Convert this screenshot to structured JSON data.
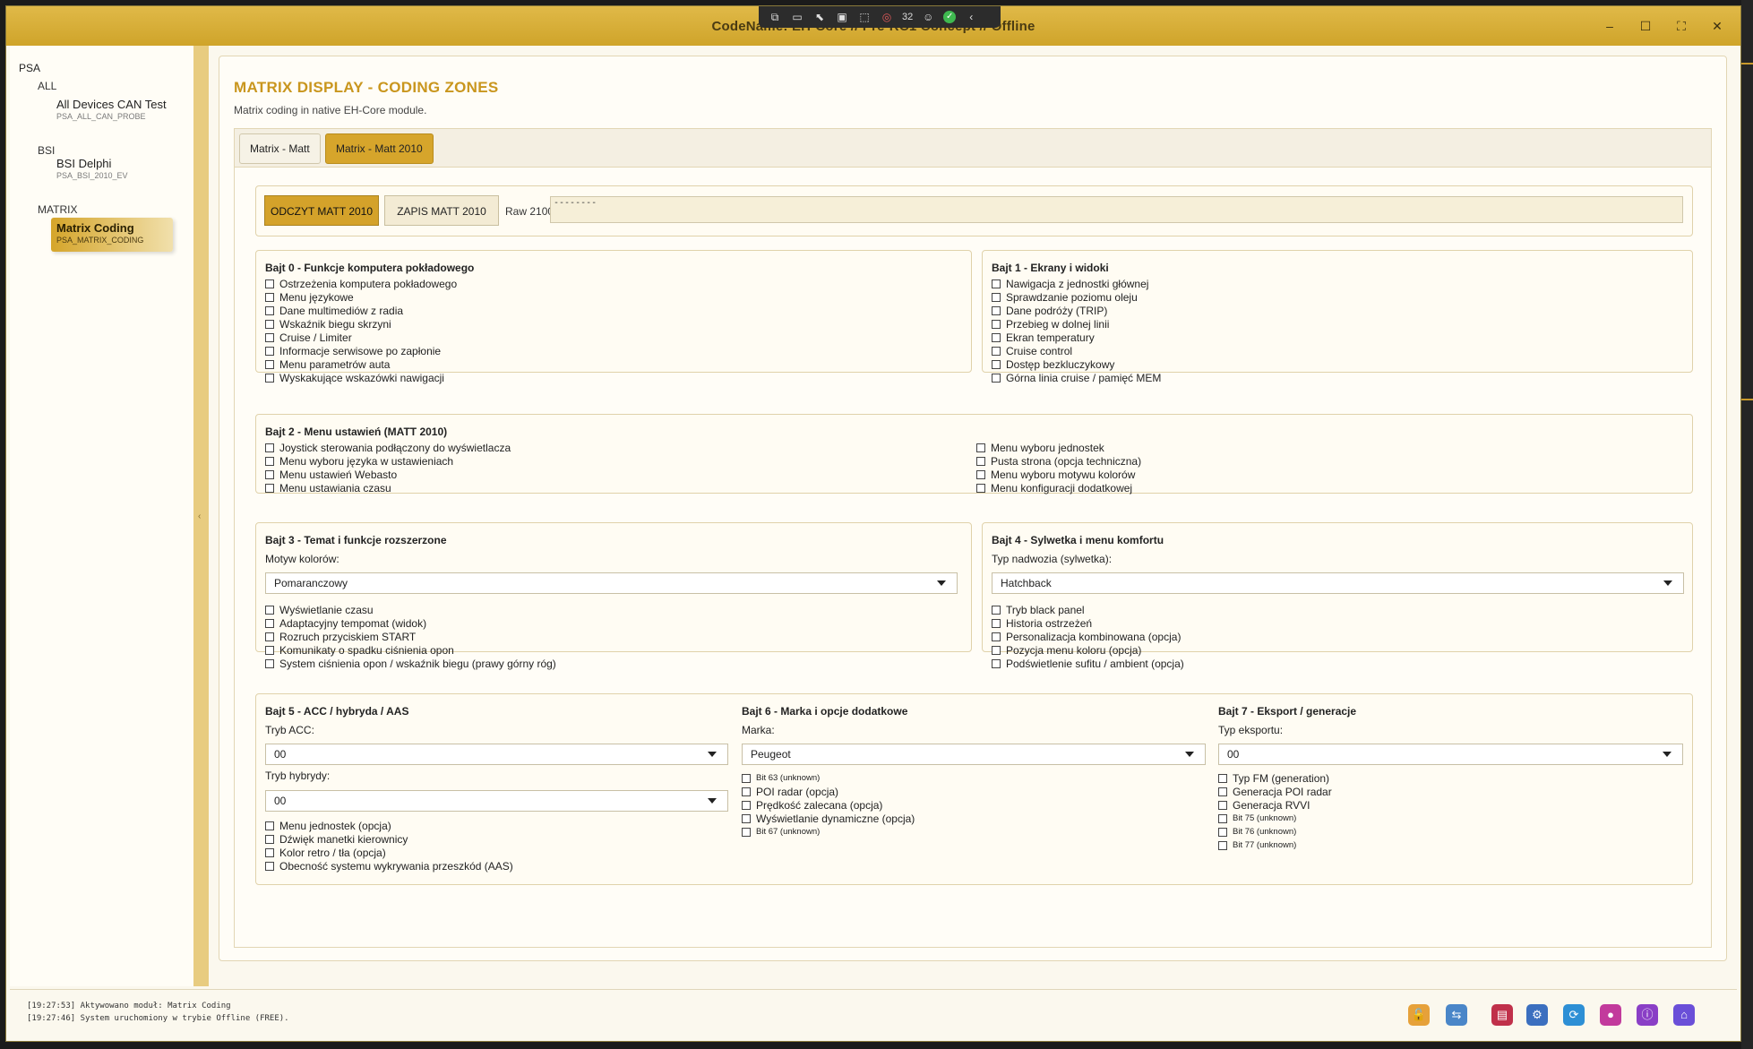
{
  "window": {
    "title": "CodeName: EH-Core // Pre-RC1 Concept // Offline",
    "overlay": {
      "counter": "32"
    },
    "controls": {
      "minimize": "–",
      "maximize": "☐",
      "fullscreen": "⛶",
      "close": "✕"
    }
  },
  "sidebar": {
    "root": "PSA",
    "groups": [
      {
        "label": "ALL",
        "items": [
          {
            "title": "All Devices CAN Test",
            "code": "PSA_ALL_CAN_PROBE"
          }
        ]
      },
      {
        "label": "BSI",
        "items": [
          {
            "title": "BSI Delphi",
            "code": "PSA_BSI_2010_EV"
          }
        ]
      },
      {
        "label": "MATRIX",
        "items": [
          {
            "title": "Matrix Coding",
            "code": "PSA_MATRIX_CODING"
          }
        ]
      }
    ]
  },
  "page": {
    "title": "MATRIX DISPLAY - CODING ZONES",
    "subtitle": "Matrix coding in native EH-Core module.",
    "tabs": [
      "Matrix - Matt",
      "Matrix - Matt 2010"
    ],
    "active_tab": "Matrix - Matt 2010"
  },
  "actions": {
    "read_label": "ODCZYT MATT 2010",
    "write_label": "ZAPIS MATT 2010",
    "raw_label": "Raw 2100:",
    "raw_value": "--------"
  },
  "byte0": {
    "title": "Bajt 0 - Funkcje komputera pokładowego",
    "items": [
      "Ostrzeżenia komputera pokładowego",
      "Menu językowe",
      "Dane multimediów z radia",
      "Wskaźnik biegu skrzyni",
      "Cruise / Limiter",
      "Informacje serwisowe po zapłonie",
      "Menu parametrów auta",
      "Wyskakujące wskazówki nawigacji"
    ]
  },
  "byte1": {
    "title": "Bajt 1 - Ekrany i widoki",
    "items": [
      "Nawigacja z jednostki głównej",
      "Sprawdzanie poziomu oleju",
      "Dane podróży (TRIP)",
      "Przebieg w dolnej linii",
      "Ekran temperatury",
      "Cruise control",
      "Dostęp bezkluczykowy",
      "Górna linia cruise / pamięć MEM"
    ]
  },
  "byte2": {
    "title": "Bajt 2 - Menu ustawień (MATT 2010)",
    "left": [
      "Joystick sterowania podłączony do wyświetlacza",
      "Menu wyboru języka w ustawieniach",
      "Menu ustawień Webasto",
      "Menu ustawiania czasu"
    ],
    "right": [
      "Menu wyboru jednostek",
      "Pusta strona (opcja techniczna)",
      "Menu wyboru motywu kolorów",
      "Menu konfiguracji dodatkowej"
    ]
  },
  "byte3": {
    "title": "Bajt 3 - Temat i funkcje rozszerzone",
    "select_label": "Motyw kolorów:",
    "select_value": "Pomaranczowy",
    "items": [
      "Wyświetlanie czasu",
      "Adaptacyjny tempomat (widok)",
      "Rozruch przyciskiem START",
      "Komunikaty o spadku ciśnienia opon",
      "System ciśnienia opon / wskaźnik biegu (prawy górny róg)"
    ]
  },
  "byte4": {
    "title": "Bajt 4 - Sylwetka i menu komfortu",
    "select_label": "Typ nadwozia (sylwetka):",
    "select_value": "Hatchback",
    "items": [
      "Tryb black panel",
      "Historia ostrzeżeń",
      "Personalizacja kombinowana (opcja)",
      "Pozycja menu koloru (opcja)",
      "Podświetlenie sufitu / ambient (opcja)"
    ]
  },
  "byte5": {
    "title": "Bajt 5 - ACC / hybryda / AAS",
    "acc_label": "Tryb ACC:",
    "acc_value": "00",
    "hybrid_label": "Tryb hybrydy:",
    "hybrid_value": "00",
    "items": [
      "Menu jednostek (opcja)",
      "Dźwięk manetki kierownicy",
      "Kolor retro / tła (opcja)",
      "Obecność systemu wykrywania przeszkód (AAS)"
    ]
  },
  "byte6": {
    "title": "Bajt 6 - Marka i opcje dodatkowe",
    "select_label": "Marka:",
    "select_value": "Peugeot",
    "items": [
      {
        "text": "Bit 63 (unknown)",
        "small": true
      },
      {
        "text": "POI radar (opcja)",
        "small": false
      },
      {
        "text": "Prędkość zalecana (opcja)",
        "small": false
      },
      {
        "text": "Wyświetlanie dynamiczne (opcja)",
        "small": false
      },
      {
        "text": "Bit 67 (unknown)",
        "small": true
      }
    ]
  },
  "byte7": {
    "title": "Bajt 7 - Eksport / generacje",
    "select_label": "Typ eksportu:",
    "select_value": "00",
    "items": [
      {
        "text": "Typ FM (generation)",
        "small": false
      },
      {
        "text": "Generacja POI radar",
        "small": false
      },
      {
        "text": "Generacja RVVI",
        "small": false
      },
      {
        "text": "Bit 75 (unknown)",
        "small": true
      },
      {
        "text": "Bit 76 (unknown)",
        "small": true
      },
      {
        "text": "Bit 77 (unknown)",
        "small": true
      }
    ]
  },
  "log": {
    "lines": [
      "[19:27:53] Aktywowano moduł: Matrix Coding",
      "[19:27:46] System uruchomiony w trybie Offline (FREE)."
    ]
  },
  "tray": {
    "icons": [
      {
        "name": "lock-icon",
        "glyph": "🔓",
        "color": "#e6a13a"
      },
      {
        "name": "network-icon",
        "glyph": "⇆",
        "color": "#4a86c8"
      },
      {
        "name": "monitor-icon",
        "glyph": "▤",
        "color": "#c0304a"
      },
      {
        "name": "gear-icon",
        "glyph": "⚙",
        "color": "#3b6fbf"
      },
      {
        "name": "sync-icon",
        "glyph": "⟳",
        "color": "#2d8fd5"
      },
      {
        "name": "user-icon",
        "glyph": "●",
        "color": "#c23a9c"
      },
      {
        "name": "info-icon",
        "glyph": "ⓘ",
        "color": "#8a3fc6"
      },
      {
        "name": "home-icon",
        "glyph": "⌂",
        "color": "#6a4fd8"
      }
    ]
  }
}
